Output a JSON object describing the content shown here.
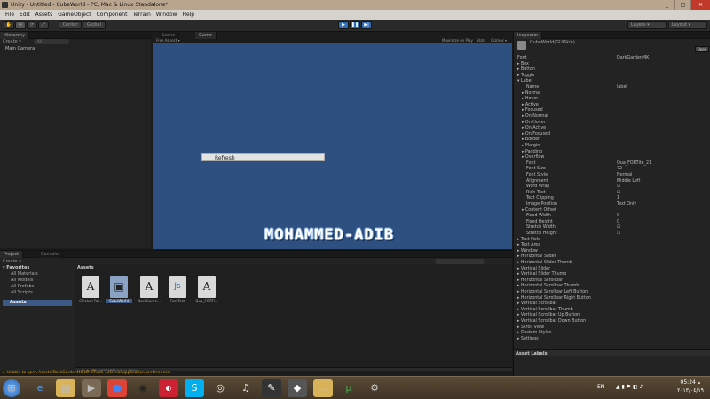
{
  "window": {
    "title": "Unity - Untitled - CubeWorld - PC, Mac & Linux Standalone*",
    "buttons": [
      "_",
      "□",
      "✕"
    ]
  },
  "menu": [
    "File",
    "Edit",
    "Assets",
    "GameObject",
    "Component",
    "Terrain",
    "Window",
    "Help"
  ],
  "toolbar": {
    "center_label": "Center",
    "global_label": "Global",
    "layers_label": "Layers",
    "layout_label": "Layout",
    "play_icon": "play-icon",
    "pause_icon": "pause-icon",
    "step_icon": "step-icon"
  },
  "hierarchy": {
    "tab": "Hierarchy",
    "create_label": "Create",
    "search_placeholder": "All",
    "items": [
      "Main Camera"
    ]
  },
  "scene_tabs": {
    "scene": "Scene",
    "game": "Game"
  },
  "game": {
    "aspect": "Free Aspect",
    "maximize": "Maximize on Play",
    "stats": "Stats",
    "gizmos": "Gizmos",
    "refresh_button": "Refresh",
    "signature": "MOHAMMED-ADIB"
  },
  "inspector": {
    "tab": "Inspector",
    "object_name": "CubeWorld(GUISkin)",
    "open_label": "Open",
    "rows": [
      {
        "label": "Font",
        "value": "DarkGardenMK",
        "indent": 0
      },
      {
        "label": "▸ Box",
        "value": "",
        "indent": 0
      },
      {
        "label": "▸ Button",
        "value": "",
        "indent": 0
      },
      {
        "label": "▸ Toggle",
        "value": "",
        "indent": 0
      },
      {
        "label": "▾ Label",
        "value": "",
        "indent": 0
      },
      {
        "label": "Name",
        "value": "label",
        "indent": 2
      },
      {
        "label": "▸ Normal",
        "value": "",
        "indent": 1
      },
      {
        "label": "▸ Hover",
        "value": "",
        "indent": 1
      },
      {
        "label": "▸ Active",
        "value": "",
        "indent": 1
      },
      {
        "label": "▸ Focused",
        "value": "",
        "indent": 1
      },
      {
        "label": "▸ On Normal",
        "value": "",
        "indent": 1
      },
      {
        "label": "▸ On Hover",
        "value": "",
        "indent": 1
      },
      {
        "label": "▸ On Active",
        "value": "",
        "indent": 1
      },
      {
        "label": "▸ On Focused",
        "value": "",
        "indent": 1
      },
      {
        "label": "▸ Border",
        "value": "",
        "indent": 1
      },
      {
        "label": "▸ Margin",
        "value": "",
        "indent": 1
      },
      {
        "label": "▸ Padding",
        "value": "",
        "indent": 1
      },
      {
        "label": "▸ Overflow",
        "value": "",
        "indent": 1
      },
      {
        "label": "Font",
        "value": "Qua_FORTite_21",
        "indent": 2
      },
      {
        "label": "Font Size",
        "value": "72",
        "indent": 2
      },
      {
        "label": "Font Style",
        "value": "Normal",
        "indent": 2
      },
      {
        "label": "Alignment",
        "value": "Middle Left",
        "indent": 2
      },
      {
        "label": "Word Wrap",
        "value": "☑",
        "indent": 2
      },
      {
        "label": "Rich Text",
        "value": "☑",
        "indent": 2
      },
      {
        "label": "Text Clipping",
        "value": "1",
        "indent": 2
      },
      {
        "label": "Image Position",
        "value": "Text Only",
        "indent": 2
      },
      {
        "label": "▸ Content Offset",
        "value": "",
        "indent": 1
      },
      {
        "label": "Fixed Width",
        "value": "0",
        "indent": 2
      },
      {
        "label": "Fixed Height",
        "value": "0",
        "indent": 2
      },
      {
        "label": "Stretch Width",
        "value": "☑",
        "indent": 2
      },
      {
        "label": "Stretch Height",
        "value": "☐",
        "indent": 2
      },
      {
        "label": "▸ Text Field",
        "value": "",
        "indent": 0
      },
      {
        "label": "▸ Text Area",
        "value": "",
        "indent": 0
      },
      {
        "label": "▸ Window",
        "value": "",
        "indent": 0
      },
      {
        "label": "▸ Horizontal Slider",
        "value": "",
        "indent": 0
      },
      {
        "label": "▸ Horizontal Slider Thumb",
        "value": "",
        "indent": 0
      },
      {
        "label": "▸ Vertical Slider",
        "value": "",
        "indent": 0
      },
      {
        "label": "▸ Vertical Slider Thumb",
        "value": "",
        "indent": 0
      },
      {
        "label": "▸ Horizontal Scrollbar",
        "value": "",
        "indent": 0
      },
      {
        "label": "▸ Horizontal Scrollbar Thumb",
        "value": "",
        "indent": 0
      },
      {
        "label": "▸ Horizontal Scrollbar Left Button",
        "value": "",
        "indent": 0
      },
      {
        "label": "▸ Horizontal Scrollbar Right Button",
        "value": "",
        "indent": 0
      },
      {
        "label": "▸ Vertical Scrollbar",
        "value": "",
        "indent": 0
      },
      {
        "label": "▸ Vertical Scrollbar Thumb",
        "value": "",
        "indent": 0
      },
      {
        "label": "▸ Vertical Scrollbar Up Button",
        "value": "",
        "indent": 0
      },
      {
        "label": "▸ Vertical Scrollbar Down Button",
        "value": "",
        "indent": 0
      },
      {
        "label": "▸ Scroll View",
        "value": "",
        "indent": 0
      },
      {
        "label": "▸ Custom Styles",
        "value": "",
        "indent": 0
      },
      {
        "label": "▸ Settings",
        "value": "",
        "indent": 0
      }
    ],
    "asset_labels": "Asset Labels"
  },
  "project": {
    "tab": "Project",
    "console_tab": "Console",
    "create_label": "Create",
    "favorites_header": "Favorites",
    "favorites": [
      "All Materials",
      "All Models",
      "All Prefabs",
      "All Scripts"
    ],
    "assets_tree_label": "Assets",
    "assets_header": "Assets",
    "assets": [
      {
        "label": "Chicken Ro...",
        "glyph": "A",
        "selected": false
      },
      {
        "label": "CubeWorld",
        "glyph": "▣",
        "selected": true
      },
      {
        "label": "DarkGarde...",
        "glyph": "A",
        "selected": false
      },
      {
        "label": "FastTest",
        "glyph": "Js",
        "selected": false
      },
      {
        "label": "Qua_FORTi...",
        "glyph": "A",
        "selected": false
      }
    ],
    "selected_path": "CubeWorld(GUISkin).guiskin"
  },
  "status": {
    "warning": "Unable to open Assets/DarkGardenMK.ttf: Check external application preferences"
  },
  "taskbar": {
    "lang": "EN",
    "time": "05:24 م",
    "date": "٢٠١٣/٠٤/١٩",
    "icons": [
      "start-icon",
      "internet-explorer-icon",
      "file-explorer-icon",
      "chrome-icon",
      "media-icon",
      "nero-icon",
      "skype-icon",
      "ccleaner-icon",
      "clipboard-icon",
      "music-icon",
      "unity-icon",
      "folder-icon",
      "utorrent-icon",
      "notes-icon",
      "network-icon"
    ]
  },
  "colors": {
    "game_bg": "#2e5080",
    "accent": "#2f6fb5"
  }
}
